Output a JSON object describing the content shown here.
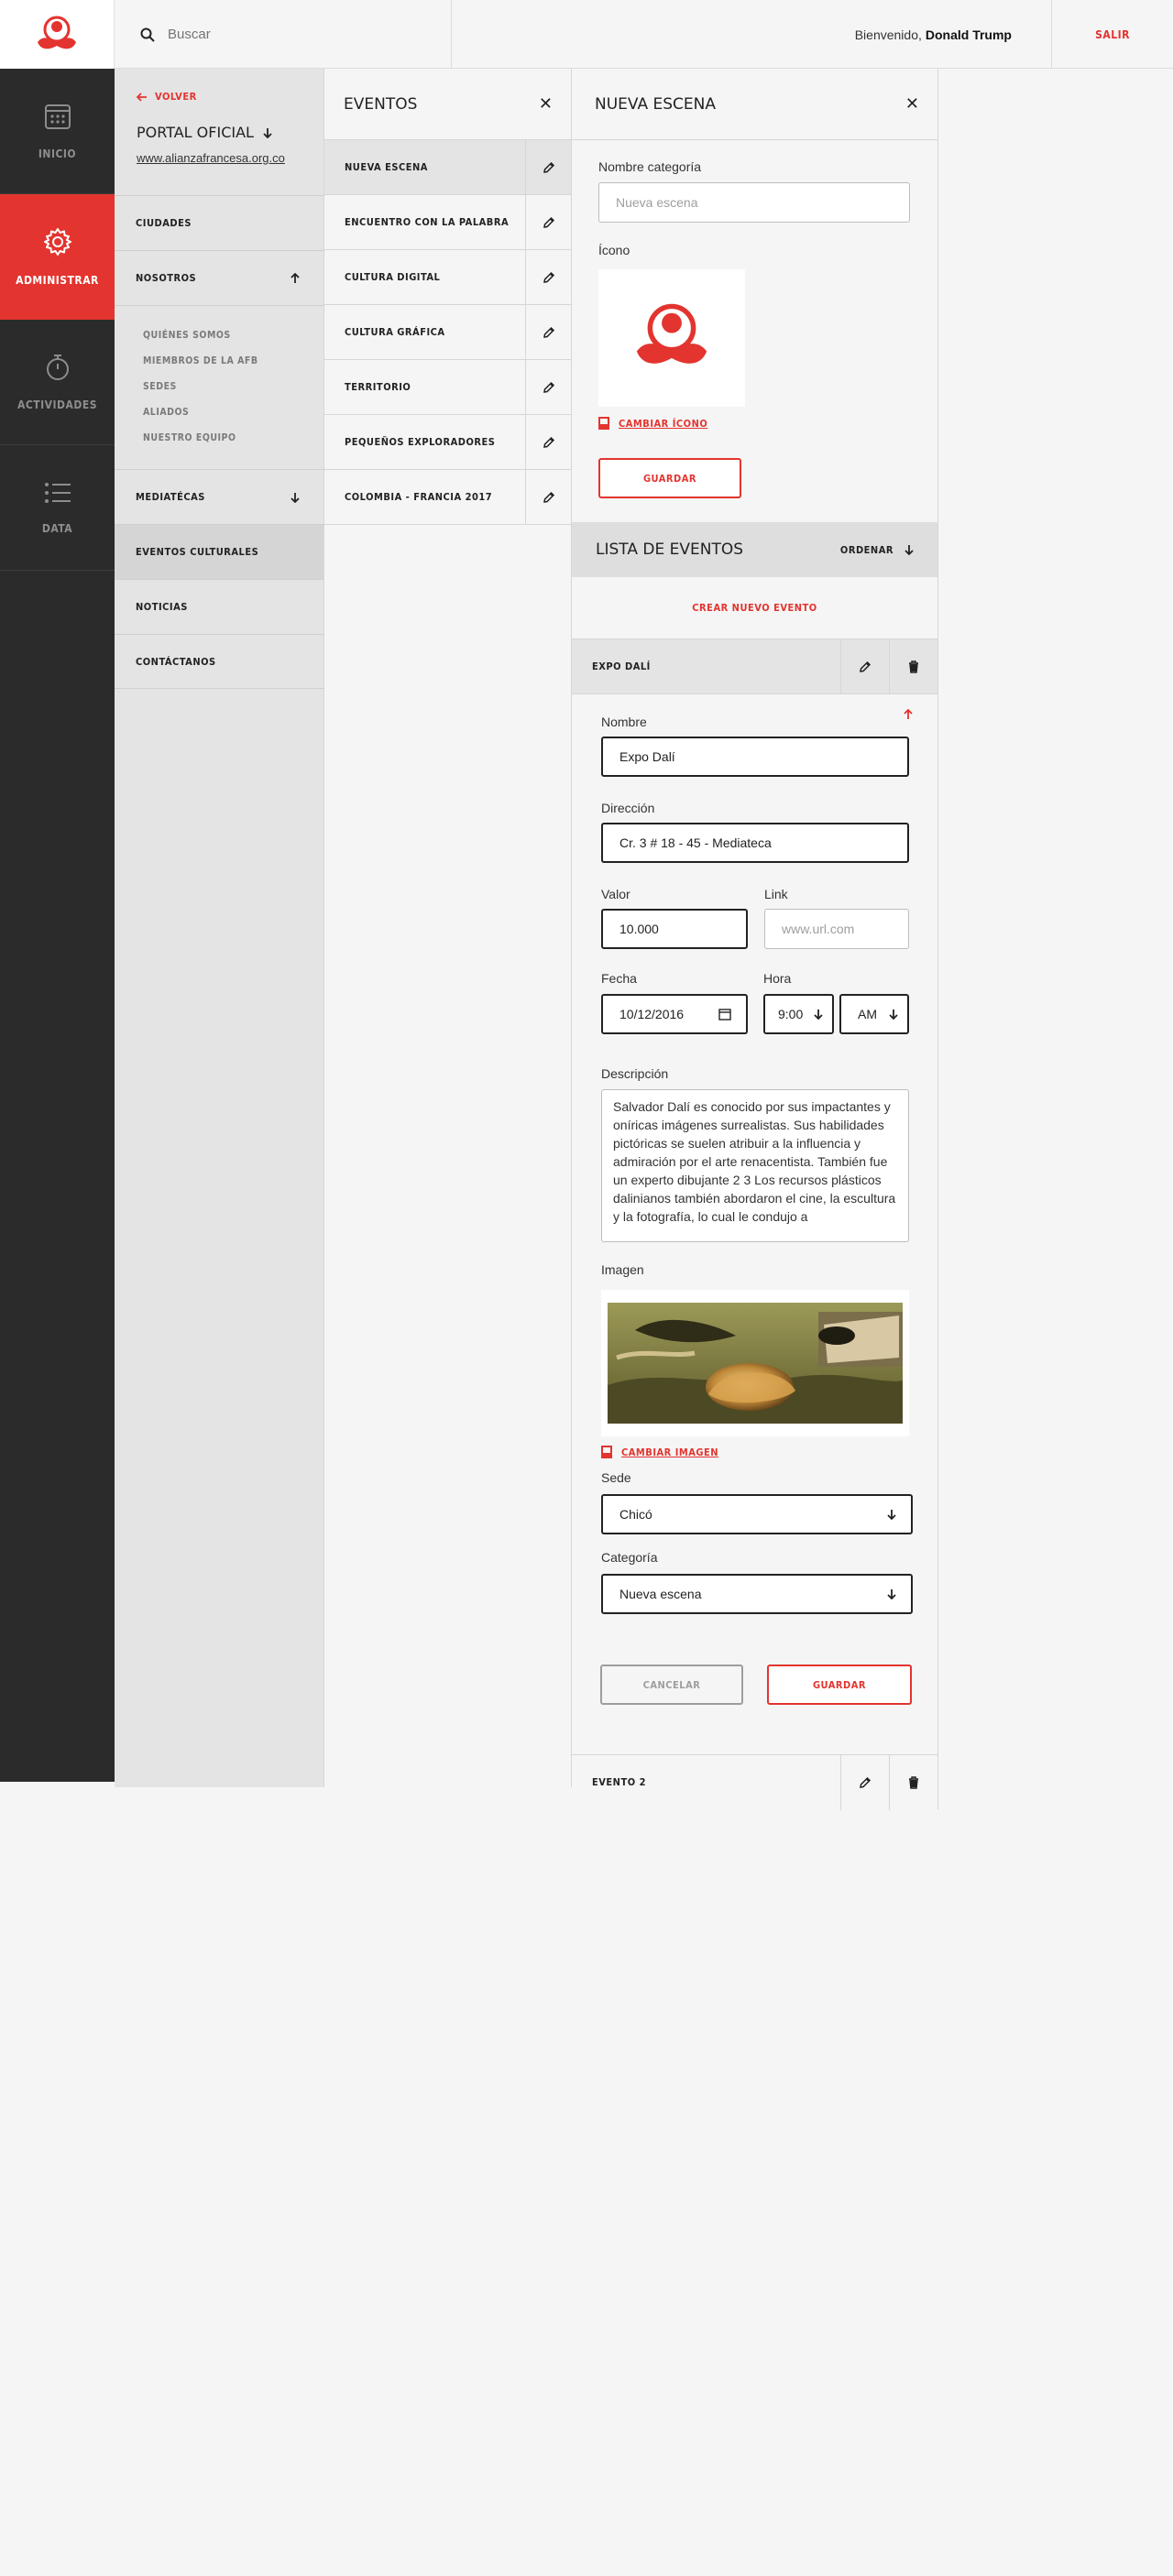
{
  "header": {
    "search_placeholder": "Buscar",
    "welcome_text": "Bienvenido,",
    "user_name": "Donald Trump",
    "logout_label": "SALIR"
  },
  "sidebar": {
    "items": [
      {
        "label": "INICIO",
        "icon": "calendar-icon"
      },
      {
        "label": "ADMINISTRAR",
        "icon": "gear-icon",
        "active": true
      },
      {
        "label": "ACTIVIDADES",
        "icon": "stopwatch-icon"
      },
      {
        "label": "DATA",
        "icon": "list-icon"
      }
    ]
  },
  "portal": {
    "back_label": "VOLVER",
    "title": "PORTAL OFICIAL",
    "url": "www.alianzafrancesa.org.co",
    "menu": {
      "ciudades": "CIUDADES",
      "nosotros": "NOSOTROS",
      "nosotros_sub": [
        "QUIÉNES SOMOS",
        "MIEMBROS DE LA AFB",
        "SEDES",
        "ALIADOS",
        "NUESTRO EQUIPO"
      ],
      "mediatecas": "MEDIATÉCAS",
      "eventos": "EVENTOS CULTURALES",
      "noticias": "NOTICIAS",
      "contactanos": "CONTÁCTANOS"
    }
  },
  "eventos": {
    "title": "EVENTOS",
    "categories": [
      "NUEVA ESCENA",
      "ENCUENTRO CON LA PALABRA",
      "CULTURA DIGITAL",
      "CULTURA GRÁFICA",
      "TERRITORIO",
      "PEQUEÑOS EXPLORADORES",
      "COLOMBIA - FRANCIA 2017"
    ]
  },
  "nueva_escena": {
    "title": "NUEVA ESCENA",
    "category_label": "Nombre categoría",
    "category_placeholder": "Nueva escena",
    "icon_label": "Ícono",
    "change_icon": "CAMBIAR ÍCONO",
    "save_label": "GUARDAR",
    "list_title": "LISTA DE EVENTOS",
    "order_label": "ORDENAR",
    "create_label": "CREAR NUEVO EVENTO"
  },
  "event_form": {
    "header_name": "EXPO DALÍ",
    "name_label": "Nombre",
    "name_value": "Expo Dalí",
    "address_label": "Dirección",
    "address_value": "Cr. 3 # 18 - 45 - Mediateca",
    "value_label": "Valor",
    "value_value": "10.000",
    "link_label": "Link",
    "link_placeholder": "www.url.com",
    "date_label": "Fecha",
    "date_value": "10/12/2016",
    "time_label": "Hora",
    "time_value": "9:00",
    "ampm_value": "AM",
    "description_label": "Descripción",
    "description_value": "Salvador Dalí es conocido por sus impactantes y oníricas imágenes surrealistas. Sus habilidades pictóricas se suelen atribuir a la influencia y admiración por el arte renacentista. También fue un experto dibujante 2 3 Los recursos plásticos dalinianos también abordaron el cine, la escultura y la fotografía, lo cual le condujo a",
    "image_label": "Imagen",
    "change_image": "CAMBIAR IMAGEN",
    "sede_label": "Sede",
    "sede_value": "Chicó",
    "category_label": "Categoría",
    "category_value": "Nueva escena",
    "cancel_label": "CANCELAR",
    "save_label": "GUARDAR"
  },
  "next_event": {
    "name": "EVENTO 2"
  },
  "colors": {
    "accent": "#e3342f",
    "dark_sidebar": "#2b2b2b",
    "panel": "#e4e4e4"
  }
}
